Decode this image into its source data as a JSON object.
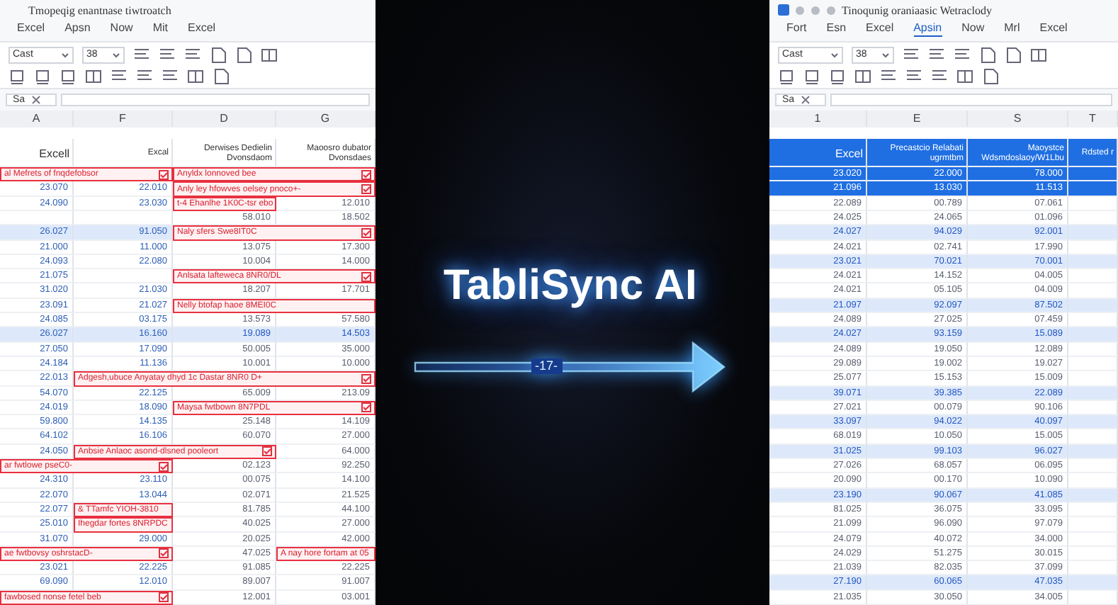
{
  "panels": [
    {
      "title": "Tmopeqig enantnase tiwtroatch",
      "menu": [
        {
          "label": "Excel",
          "selected": false
        },
        {
          "label": "Apsn",
          "selected": false
        },
        {
          "label": "Now",
          "selected": false
        },
        {
          "label": "Mit",
          "selected": false
        },
        {
          "label": "Excel",
          "selected": false
        }
      ],
      "font": {
        "name": "Cast",
        "size": "38"
      },
      "cell_ref": "Sa",
      "columns": [
        "A",
        "F",
        "D",
        "G"
      ],
      "header": {
        "selected": false,
        "cells": [
          "Excell",
          "Excal",
          "Derwises Dedielin Dvonsdaom",
          "Maoosro dubator Dvonsdaes"
        ]
      },
      "rows": [
        {
          "banded": false,
          "selected": false,
          "cells": [
            {
              "kind": "widenote",
              "text": "al Mefrets of fnqdefobsor",
              "icon": true
            },
            {
              "kind": "widenote",
              "text": "Anyldx lonnoved bee",
              "icon": true
            }
          ]
        },
        {
          "banded": false,
          "selected": false,
          "cells": [
            {
              "kind": "value",
              "text": "23.070"
            },
            {
              "kind": "value",
              "text": "22.010"
            },
            {
              "kind": "widenote",
              "text": "Anly ley hfowves oelsey pnoco+-",
              "icon": true
            }
          ]
        },
        {
          "banded": false,
          "selected": false,
          "cells": [
            {
              "kind": "value",
              "text": "24.090"
            },
            {
              "kind": "value",
              "text": "23.030"
            },
            {
              "kind": "note",
              "text": "t-4 Ehanlhe 1K0C-tsr ebo",
              "icon": false
            },
            {
              "kind": "value",
              "text": "12.010"
            }
          ]
        },
        {
          "banded": false,
          "selected": false,
          "cells": [
            {
              "kind": "empty"
            },
            {
              "kind": "empty"
            },
            {
              "kind": "value",
              "text": "58.010"
            },
            {
              "kind": "value",
              "text": "18.502"
            }
          ]
        },
        {
          "banded": true,
          "selected": false,
          "cells": [
            {
              "kind": "value",
              "text": "26.027"
            },
            {
              "kind": "value",
              "text": "91.050"
            },
            {
              "kind": "widenote",
              "text": "Naly sfers Swe8IT0C",
              "icon": true
            }
          ]
        },
        {
          "banded": false,
          "selected": false,
          "cells": [
            {
              "kind": "value",
              "text": "21.000"
            },
            {
              "kind": "value",
              "text": "11.000"
            },
            {
              "kind": "value",
              "text": "13.075"
            },
            {
              "kind": "value",
              "text": "17.300"
            }
          ]
        },
        {
          "banded": false,
          "selected": false,
          "cells": [
            {
              "kind": "value",
              "text": "24.093"
            },
            {
              "kind": "value",
              "text": "22.080"
            },
            {
              "kind": "value",
              "text": "10.004"
            },
            {
              "kind": "value",
              "text": "14.000"
            }
          ]
        },
        {
          "banded": false,
          "selected": false,
          "cells": [
            {
              "kind": "dim",
              "text": "21.075"
            },
            {
              "kind": "empty"
            },
            {
              "kind": "widenote",
              "text": "Anlsata lafteweca 8NR0/DL",
              "icon": true
            }
          ]
        },
        {
          "banded": false,
          "selected": false,
          "cells": [
            {
              "kind": "value",
              "text": "31.020"
            },
            {
              "kind": "value",
              "text": "21.030"
            },
            {
              "kind": "value",
              "text": "18.207"
            },
            {
              "kind": "value",
              "text": "17.701"
            }
          ]
        },
        {
          "banded": false,
          "selected": false,
          "cells": [
            {
              "kind": "value",
              "text": "23.091"
            },
            {
              "kind": "value",
              "text": "21.027"
            },
            {
              "kind": "widenote",
              "text": "Nelly btofap haoe 8MEI0C",
              "icon": false
            }
          ]
        },
        {
          "banded": false,
          "selected": false,
          "cells": [
            {
              "kind": "value",
              "text": "24.085"
            },
            {
              "kind": "value",
              "text": "03.175"
            },
            {
              "kind": "value",
              "text": "13.573"
            },
            {
              "kind": "value",
              "text": "57.580"
            }
          ]
        },
        {
          "banded": true,
          "selected": false,
          "cells": [
            {
              "kind": "value",
              "text": "26.027"
            },
            {
              "kind": "value",
              "text": "16.160"
            },
            {
              "kind": "value",
              "text": "19.089"
            },
            {
              "kind": "value",
              "text": "14.503"
            }
          ]
        },
        {
          "banded": false,
          "selected": false,
          "cells": [
            {
              "kind": "value",
              "text": "27.050"
            },
            {
              "kind": "value",
              "text": "17.090"
            },
            {
              "kind": "value",
              "text": "50.005"
            },
            {
              "kind": "value",
              "text": "35.000"
            }
          ]
        },
        {
          "banded": false,
          "selected": false,
          "cells": [
            {
              "kind": "value",
              "text": "24.184"
            },
            {
              "kind": "value",
              "text": "11.136"
            },
            {
              "kind": "value",
              "text": "10.001"
            },
            {
              "kind": "value",
              "text": "10.000"
            }
          ]
        },
        {
          "banded": false,
          "selected": false,
          "cells": [
            {
              "kind": "value",
              "text": "22.013"
            },
            {
              "kind": "longnote",
              "text": "Adgesh,ubuce Anyatay dhyd 1c Dastar 8NR0 D+",
              "icon": true
            }
          ]
        },
        {
          "banded": false,
          "selected": false,
          "cells": [
            {
              "kind": "value",
              "text": "54.070"
            },
            {
              "kind": "value",
              "text": "22.125"
            },
            {
              "kind": "value",
              "text": "65.009"
            },
            {
              "kind": "value",
              "text": "213.09"
            }
          ]
        },
        {
          "banded": false,
          "selected": false,
          "cells": [
            {
              "kind": "value",
              "text": "24.019"
            },
            {
              "kind": "value",
              "text": "18.090"
            },
            {
              "kind": "widenote",
              "text": "Maysa fwtbown 8N7PDL",
              "icon": true
            }
          ]
        },
        {
          "banded": false,
          "selected": false,
          "cells": [
            {
              "kind": "value",
              "text": "59.800"
            },
            {
              "kind": "value",
              "text": "14.135"
            },
            {
              "kind": "value",
              "text": "25.148"
            },
            {
              "kind": "value",
              "text": "14.109"
            }
          ]
        },
        {
          "banded": false,
          "selected": false,
          "cells": [
            {
              "kind": "value",
              "text": "64.102"
            },
            {
              "kind": "value",
              "text": "16.106"
            },
            {
              "kind": "value",
              "text": "60.070"
            },
            {
              "kind": "value",
              "text": "27.000"
            }
          ]
        },
        {
          "banded": false,
          "selected": false,
          "cells": [
            {
              "kind": "value",
              "text": "24.050"
            },
            {
              "kind": "widenote",
              "text": "Anbsie Anlaoc asond-dlsned pooleort",
              "icon": true
            },
            {
              "kind": "value",
              "text": "64.000"
            }
          ]
        },
        {
          "banded": false,
          "selected": false,
          "cells": [
            {
              "kind": "widenote",
              "text": "ar fwtlowe pseC0-",
              "icon": true
            },
            {
              "kind": "value",
              "text": "02.123"
            },
            {
              "kind": "value",
              "text": "92.250"
            }
          ]
        },
        {
          "banded": false,
          "selected": false,
          "cells": [
            {
              "kind": "value",
              "text": "24.310"
            },
            {
              "kind": "value",
              "text": "23.110"
            },
            {
              "kind": "value",
              "text": "00.075"
            },
            {
              "kind": "value",
              "text": "14.100"
            }
          ]
        },
        {
          "banded": false,
          "selected": false,
          "cells": [
            {
              "kind": "value",
              "text": "22.070"
            },
            {
              "kind": "value",
              "text": "13.044"
            },
            {
              "kind": "value",
              "text": "02.071"
            },
            {
              "kind": "value",
              "text": "21.525"
            }
          ]
        },
        {
          "banded": false,
          "selected": false,
          "cells": [
            {
              "kind": "value",
              "text": "22.077"
            },
            {
              "kind": "note",
              "text": "& TTamfc YIOH-3810",
              "icon": false
            },
            {
              "kind": "value",
              "text": "81.785"
            },
            {
              "kind": "value",
              "text": "44.100"
            }
          ]
        },
        {
          "banded": false,
          "selected": false,
          "cells": [
            {
              "kind": "value",
              "text": "25.010"
            },
            {
              "kind": "note",
              "text": "Ihegdar fortes 8NRPDC",
              "icon": false
            },
            {
              "kind": "value",
              "text": "40.025"
            },
            {
              "kind": "value",
              "text": "27.000"
            }
          ]
        },
        {
          "banded": false,
          "selected": false,
          "cells": [
            {
              "kind": "value",
              "text": "31.070"
            },
            {
              "kind": "value",
              "text": "29.000"
            },
            {
              "kind": "value",
              "text": "20.025"
            },
            {
              "kind": "value",
              "text": "42.000"
            }
          ]
        },
        {
          "banded": false,
          "selected": false,
          "cells": [
            {
              "kind": "widenote",
              "text": "ae fwtbovsy oshrstacD-",
              "icon": true
            },
            {
              "kind": "value",
              "text": "47.025"
            },
            {
              "kind": "note",
              "text": "A nay hore fortam at 05",
              "icon": false
            }
          ]
        },
        {
          "banded": false,
          "selected": false,
          "cells": [
            {
              "kind": "value",
              "text": "23.021"
            },
            {
              "kind": "value",
              "text": "22.225"
            },
            {
              "kind": "value",
              "text": "91.085"
            },
            {
              "kind": "value",
              "text": "22.225"
            }
          ]
        },
        {
          "banded": false,
          "selected": false,
          "cells": [
            {
              "kind": "value",
              "text": "69.090"
            },
            {
              "kind": "value",
              "text": "12.010"
            },
            {
              "kind": "value",
              "text": "89.007"
            },
            {
              "kind": "value",
              "text": "91.007"
            }
          ]
        },
        {
          "banded": false,
          "selected": false,
          "cells": [
            {
              "kind": "widenote",
              "text": "fawbosed nonse fetel beb",
              "icon": true
            },
            {
              "kind": "value",
              "text": "12.001"
            },
            {
              "kind": "value",
              "text": "03.001"
            }
          ]
        }
      ]
    },
    {
      "title": "Tinoqunig oraniaasic Wetraclody",
      "menu": [
        {
          "label": "Fort",
          "selected": false
        },
        {
          "label": "Esn",
          "selected": false
        },
        {
          "label": "Excel",
          "selected": false
        },
        {
          "label": "Apsin",
          "selected": true
        },
        {
          "label": "Now",
          "selected": false
        },
        {
          "label": "Mrl",
          "selected": false
        },
        {
          "label": "Excel",
          "selected": false
        }
      ],
      "font": {
        "name": "Cast",
        "size": "38"
      },
      "cell_ref": "Sa",
      "columns": [
        "1",
        "E",
        "S",
        "T"
      ],
      "header": {
        "selected": true,
        "cells": [
          "Excel",
          "Precastcio Relabati ugrmtbm",
          "Maoystce Wdsmdoslaoy/W1Lbu",
          "Rdsted r"
        ]
      },
      "rows": [
        {
          "banded": false,
          "selected": true,
          "cells": [
            {
              "kind": "value",
              "text": "23.020"
            },
            {
              "kind": "value",
              "text": "22.000"
            },
            {
              "kind": "value",
              "text": "78.000"
            }
          ]
        },
        {
          "banded": false,
          "selected": true,
          "cells": [
            {
              "kind": "value",
              "text": "21.096"
            },
            {
              "kind": "value",
              "text": "13.030"
            },
            {
              "kind": "value",
              "text": "11.513"
            }
          ]
        },
        {
          "banded": false,
          "selected": false,
          "cells": [
            {
              "kind": "value",
              "text": "22.089"
            },
            {
              "kind": "value",
              "text": "00.789"
            },
            {
              "kind": "value",
              "text": "07.061"
            }
          ]
        },
        {
          "banded": false,
          "selected": false,
          "cells": [
            {
              "kind": "value",
              "text": "24.025"
            },
            {
              "kind": "value",
              "text": "24.065"
            },
            {
              "kind": "value",
              "text": "01.096"
            }
          ]
        },
        {
          "banded": true,
          "selected": false,
          "cells": [
            {
              "kind": "value",
              "text": "24.027"
            },
            {
              "kind": "value",
              "text": "94.029"
            },
            {
              "kind": "value",
              "text": "92.001"
            }
          ]
        },
        {
          "banded": false,
          "selected": false,
          "cells": [
            {
              "kind": "value",
              "text": "24.021"
            },
            {
              "kind": "value",
              "text": "02.741"
            },
            {
              "kind": "value",
              "text": "17.990"
            }
          ]
        },
        {
          "banded": true,
          "selected": false,
          "cells": [
            {
              "kind": "value",
              "text": "23.021"
            },
            {
              "kind": "value",
              "text": "70.021"
            },
            {
              "kind": "value",
              "text": "70.001"
            }
          ]
        },
        {
          "banded": false,
          "selected": false,
          "cells": [
            {
              "kind": "value",
              "text": "24.021"
            },
            {
              "kind": "value",
              "text": "14.152"
            },
            {
              "kind": "value",
              "text": "04.005"
            }
          ]
        },
        {
          "banded": false,
          "selected": false,
          "cells": [
            {
              "kind": "value",
              "text": "24.021"
            },
            {
              "kind": "value",
              "text": "05.105"
            },
            {
              "kind": "value",
              "text": "04.009"
            }
          ]
        },
        {
          "banded": true,
          "selected": false,
          "cells": [
            {
              "kind": "value",
              "text": "21.097"
            },
            {
              "kind": "value",
              "text": "92.097"
            },
            {
              "kind": "value",
              "text": "87.502"
            }
          ]
        },
        {
          "banded": false,
          "selected": false,
          "cells": [
            {
              "kind": "value",
              "text": "24.089"
            },
            {
              "kind": "value",
              "text": "27.025"
            },
            {
              "kind": "value",
              "text": "07.459"
            }
          ]
        },
        {
          "banded": true,
          "selected": false,
          "cells": [
            {
              "kind": "value",
              "text": "24.027"
            },
            {
              "kind": "value",
              "text": "93.159"
            },
            {
              "kind": "value",
              "text": "15.089"
            }
          ]
        },
        {
          "banded": false,
          "selected": false,
          "cells": [
            {
              "kind": "value",
              "text": "24.089"
            },
            {
              "kind": "value",
              "text": "19.050"
            },
            {
              "kind": "value",
              "text": "12.089"
            }
          ]
        },
        {
          "banded": false,
          "selected": false,
          "cells": [
            {
              "kind": "value",
              "text": "29.089"
            },
            {
              "kind": "value",
              "text": "19.002"
            },
            {
              "kind": "value",
              "text": "19.027"
            }
          ]
        },
        {
          "banded": false,
          "selected": false,
          "cells": [
            {
              "kind": "value",
              "text": "25.077"
            },
            {
              "kind": "value",
              "text": "15.153"
            },
            {
              "kind": "value",
              "text": "15.009"
            }
          ]
        },
        {
          "banded": true,
          "selected": false,
          "cells": [
            {
              "kind": "value",
              "text": "39.071"
            },
            {
              "kind": "value",
              "text": "39.385"
            },
            {
              "kind": "value",
              "text": "22.089"
            }
          ]
        },
        {
          "banded": false,
          "selected": false,
          "cells": [
            {
              "kind": "value",
              "text": "27.021"
            },
            {
              "kind": "value",
              "text": "00.079"
            },
            {
              "kind": "value",
              "text": "90.106"
            }
          ]
        },
        {
          "banded": true,
          "selected": false,
          "cells": [
            {
              "kind": "value",
              "text": "33.097"
            },
            {
              "kind": "value",
              "text": "94.022"
            },
            {
              "kind": "value",
              "text": "40.097"
            }
          ]
        },
        {
          "banded": false,
          "selected": false,
          "cells": [
            {
              "kind": "value",
              "text": "68.019"
            },
            {
              "kind": "value",
              "text": "10.050"
            },
            {
              "kind": "value",
              "text": "15.005"
            }
          ]
        },
        {
          "banded": true,
          "selected": false,
          "cells": [
            {
              "kind": "value",
              "text": "31.025"
            },
            {
              "kind": "value",
              "text": "99.103"
            },
            {
              "kind": "value",
              "text": "96.027"
            }
          ]
        },
        {
          "banded": false,
          "selected": false,
          "cells": [
            {
              "kind": "value",
              "text": "27.026"
            },
            {
              "kind": "value",
              "text": "68.057"
            },
            {
              "kind": "value",
              "text": "06.095"
            }
          ]
        },
        {
          "banded": false,
          "selected": false,
          "cells": [
            {
              "kind": "value",
              "text": "20.090"
            },
            {
              "kind": "value",
              "text": "00.170"
            },
            {
              "kind": "value",
              "text": "10.090"
            }
          ]
        },
        {
          "banded": true,
          "selected": false,
          "cells": [
            {
              "kind": "value",
              "text": "23.190"
            },
            {
              "kind": "value",
              "text": "90.067"
            },
            {
              "kind": "value",
              "text": "41.085"
            }
          ]
        },
        {
          "banded": false,
          "selected": false,
          "cells": [
            {
              "kind": "value",
              "text": "81.025"
            },
            {
              "kind": "value",
              "text": "36.075"
            },
            {
              "kind": "value",
              "text": "33.095"
            }
          ]
        },
        {
          "banded": false,
          "selected": false,
          "cells": [
            {
              "kind": "value",
              "text": "21.099"
            },
            {
              "kind": "value",
              "text": "96.090"
            },
            {
              "kind": "value",
              "text": "97.079"
            }
          ]
        },
        {
          "banded": false,
          "selected": false,
          "cells": [
            {
              "kind": "value",
              "text": "24.079"
            },
            {
              "kind": "value",
              "text": "40.072"
            },
            {
              "kind": "value",
              "text": "34.000"
            }
          ]
        },
        {
          "banded": false,
          "selected": false,
          "cells": [
            {
              "kind": "value",
              "text": "24.029"
            },
            {
              "kind": "value",
              "text": "51.275"
            },
            {
              "kind": "value",
              "text": "30.015"
            }
          ]
        },
        {
          "banded": false,
          "selected": false,
          "cells": [
            {
              "kind": "value",
              "text": "21.039"
            },
            {
              "kind": "value",
              "text": "82.035"
            },
            {
              "kind": "value",
              "text": "37.099"
            }
          ]
        },
        {
          "banded": true,
          "selected": false,
          "cells": [
            {
              "kind": "value",
              "text": "27.190"
            },
            {
              "kind": "value",
              "text": "60.065"
            },
            {
              "kind": "value",
              "text": "47.035"
            }
          ]
        },
        {
          "banded": false,
          "selected": false,
          "cells": [
            {
              "kind": "value",
              "text": "21.035"
            },
            {
              "kind": "value",
              "text": "30.050"
            },
            {
              "kind": "value",
              "text": "34.005"
            }
          ]
        }
      ]
    }
  ],
  "center": {
    "title": "TabliSync AI",
    "arrow_label": "-17-"
  }
}
